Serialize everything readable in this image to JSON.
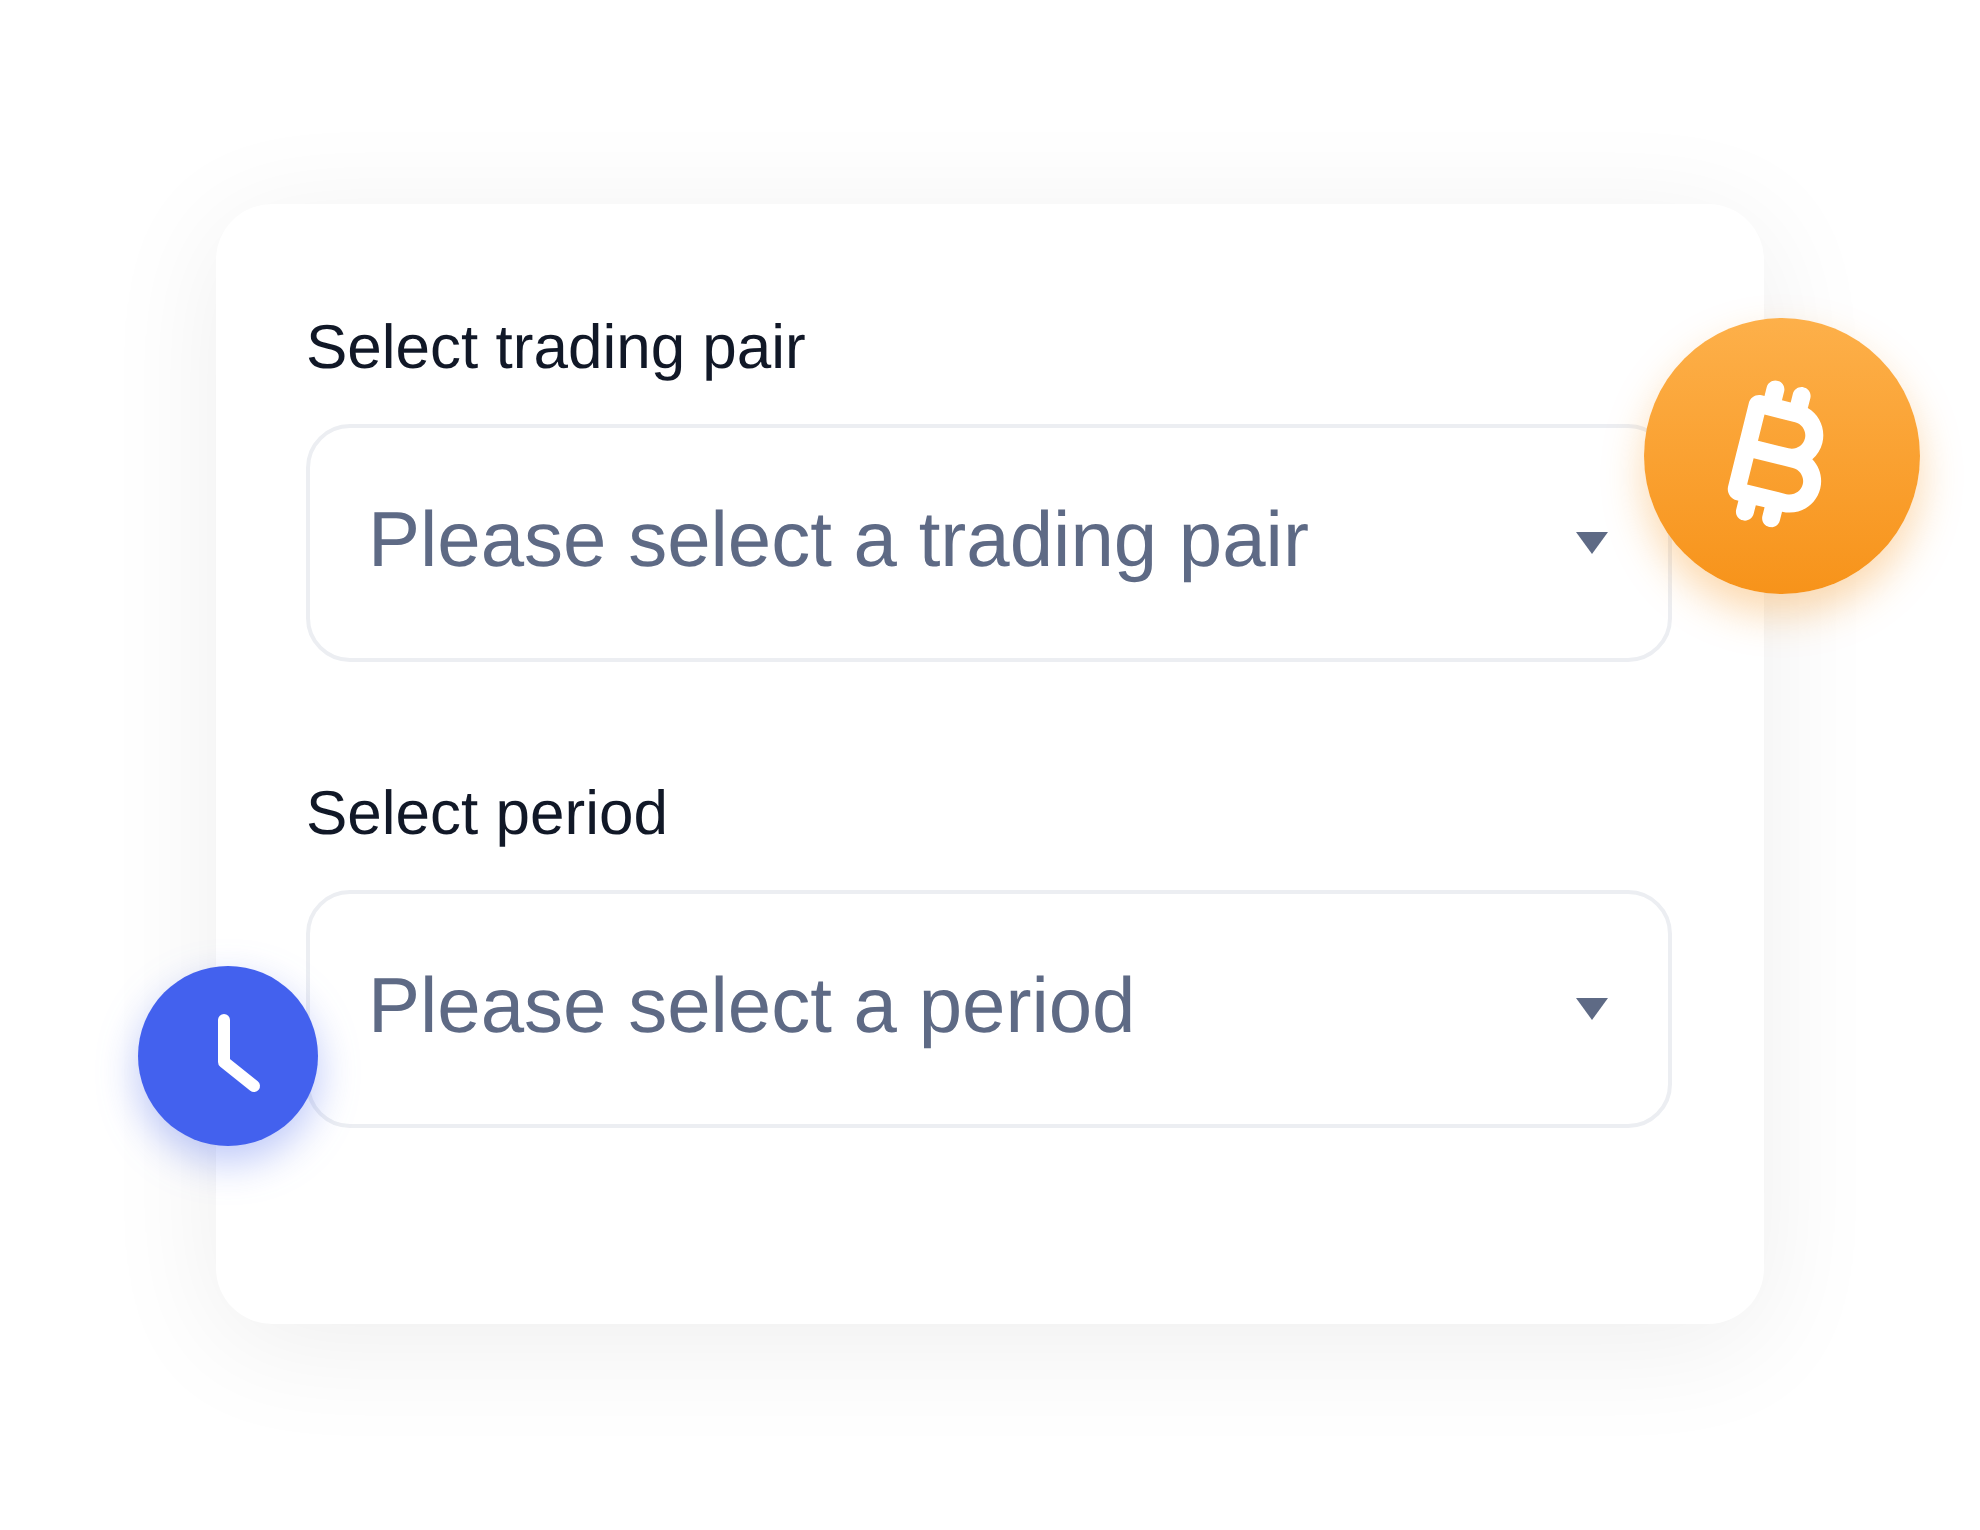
{
  "fields": [
    {
      "label": "Select trading pair",
      "placeholder": "Please select a trading pair"
    },
    {
      "label": "Select period",
      "placeholder": "Please select a period"
    }
  ]
}
